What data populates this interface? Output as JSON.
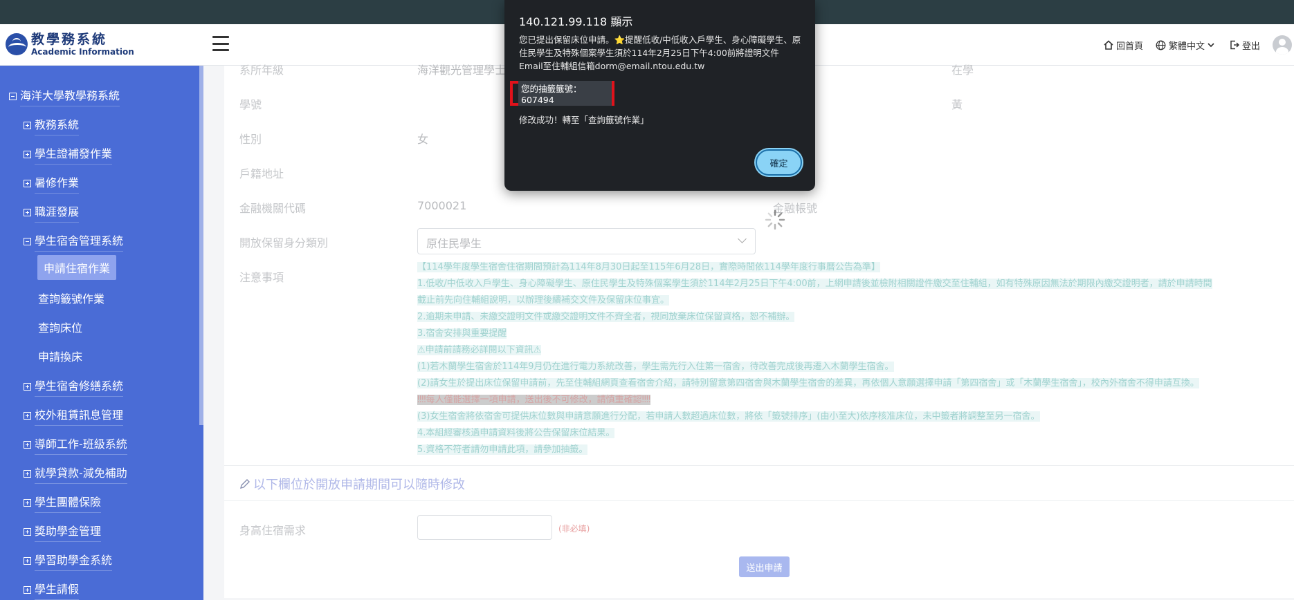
{
  "header": {
    "logo_cn": "教學務系統",
    "logo_en": "Academic Information",
    "nav": {
      "home": "回首頁",
      "language": "繁體中文",
      "logout": "登出"
    }
  },
  "sidebar": {
    "root": "海洋大學教學務系統",
    "items": [
      {
        "label": "教務系統",
        "expanded": false
      },
      {
        "label": "學生證補發作業",
        "expanded": false
      },
      {
        "label": "暑修作業",
        "expanded": false
      },
      {
        "label": "職涯發展",
        "expanded": false
      },
      {
        "label": "學生宿舍管理系統",
        "expanded": true
      },
      {
        "label": "學生宿舍修繕系統",
        "expanded": false
      },
      {
        "label": "校外租賃訊息管理",
        "expanded": false
      },
      {
        "label": "導師工作-班級系統",
        "expanded": false
      },
      {
        "label": "就學貸款-減免補助",
        "expanded": false
      },
      {
        "label": "學生團體保險",
        "expanded": false
      },
      {
        "label": "獎助學金管理",
        "expanded": false
      },
      {
        "label": "學習助學金系統",
        "expanded": false
      },
      {
        "label": "學生請假",
        "expanded": false
      }
    ],
    "subitems": [
      {
        "label": "申請住宿作業",
        "active": true
      },
      {
        "label": "查詢籤號作業",
        "active": false
      },
      {
        "label": "查詢床位",
        "active": false
      },
      {
        "label": "申請換床",
        "active": false
      }
    ]
  },
  "form": {
    "rows": [
      {
        "label": "系所年級",
        "value": "海洋觀光管理學士",
        "value2": "在學"
      },
      {
        "label": "學號",
        "value": "",
        "value2": "黃"
      },
      {
        "label": "性別",
        "value": "女",
        "value2": ""
      },
      {
        "label": "戶籍地址",
        "value": "",
        "value2": ""
      },
      {
        "label": "金融機關代碼",
        "value": "7000021",
        "value2": "金融帳號"
      }
    ],
    "category_label": "開放保留身分類別",
    "category_value": "原住民學生",
    "notes_label": "注意事項",
    "notes": [
      "【114學年度學生宿舍住宿期間預計為114年8月30日起至115年6月28日，實際時間依114學年度行事曆公告為準】",
      "1.低收/中低收入戶學生、身心障礙學生、原住民學生及特殊個案學生須於114年2月25日下午4:00前，上網申請後並檢附相關證件繳交至住輔組，如有特殊原因無法於期限內繳交證明者，請於申請時間",
      "截止前先向住輔組說明，以辦理後續補交文件及保留床位事宜。",
      "2.逾期未申請、未繳交證明文件或繳交證明文件不齊全者，視同放棄床位保留資格，恕不補辦。",
      "3.宿舍安排與重要提醒",
      "⚠申請前請務必詳閱以下資訊⚠",
      "(1)若木蘭學生宿舍於114年9月仍在進行電力系統改善，學生需先行入住第一宿舍，待改善完成後再遷入木蘭學生宿舍。",
      "(2)請女生於提出床位保留申請前，先至住輔組網頁查看宿舍介紹，請特別留意第四宿舍與木蘭學生宿舍的差異，再依個人意願選擇申請「第四宿舍」或「木蘭學生宿舍」，校內外宿舍不得申請互換。",
      "‼‼每人僅能選擇一項申請，送出後不可修改，請慎重確認‼‼",
      "(3)女生宿舍將依宿舍可提供床位數與申請意願進行分配，若申請人數超過床位數，將依「籤號排序」(由小至大)依序核准床位，未中籤者將調整至另一宿舍。",
      "4.本組經審核過申請資料後將公告保留床位結果。",
      "5.資格不符者請勿申請此項，請參加抽籤。"
    ],
    "section_title": "以下欄位於開放申請期間可以隨時修改",
    "height_label": "身高住宿需求",
    "height_value": "",
    "optional": "(非必填)",
    "submit": "送出申請"
  },
  "dialog": {
    "title": "140.121.99.118 顯示",
    "message": "您已提出保留床位申請。⭐提醒低收/中低收入戶學生、身心障礙學生、原住民學生及特殊個案學生須於114年2月25日下午4:00前將證明文件Email至住輔組信箱dorm@email.ntou.edu.tw",
    "code": "您的抽籤籤號：607494",
    "success": "修改成功！轉至「查詢籤號作業」",
    "ok": "確定"
  },
  "colors": {
    "sidebar": "#4a6cd6",
    "topbar": "#2c3e44",
    "dialog_bg": "#1f2226",
    "highlight_border": "#e0121b",
    "ok_button": "#8ad3f6"
  }
}
